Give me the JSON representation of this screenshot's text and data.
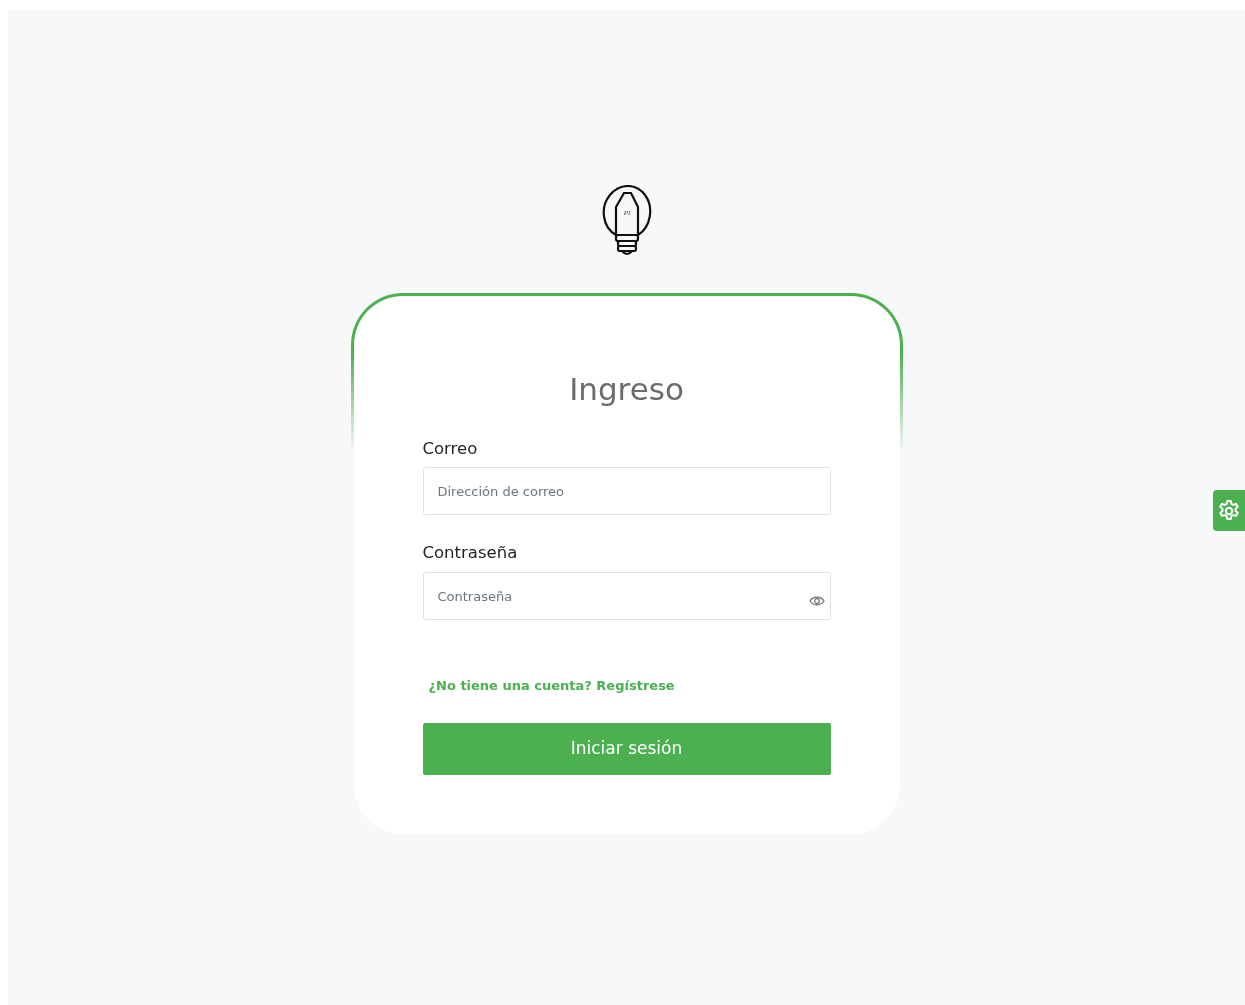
{
  "logo": {
    "text": "PI"
  },
  "login": {
    "title": "Ingreso",
    "fields": [
      {
        "label": "Correo",
        "placeholder": "Dirección de correo",
        "kind": "text"
      },
      {
        "label": "Contraseña",
        "placeholder": "Contraseña",
        "kind": "password"
      }
    ],
    "register_link": "¿No tiene una cuenta? Regístrese",
    "submit": "Iniciar sesión"
  },
  "settings_button": {
    "kind": "gear"
  }
}
